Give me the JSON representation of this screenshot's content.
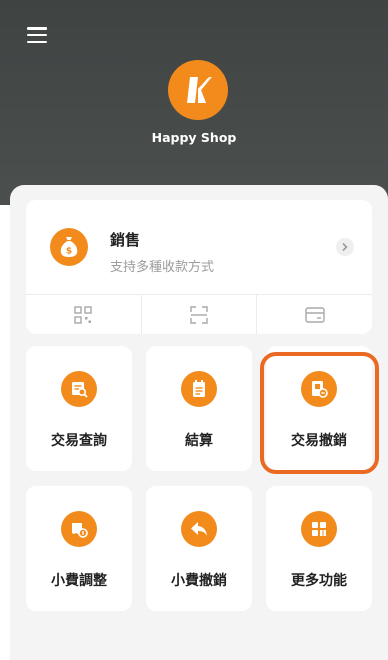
{
  "header": {
    "menu_icon": "hamburger-menu-icon",
    "logo_icon": "shop-logo-k-icon",
    "shop_name": "Happy Shop"
  },
  "sale": {
    "icon": "money-bag-icon",
    "title": "銷售",
    "subtitle": "支持多種收款方式",
    "chevron_icon": "chevron-right-icon",
    "payment_methods": [
      {
        "icon": "qr-code-icon"
      },
      {
        "icon": "scan-icon"
      },
      {
        "icon": "card-icon"
      }
    ]
  },
  "functions": [
    {
      "label": "交易查詢",
      "icon": "transaction-search-icon"
    },
    {
      "label": "結算",
      "icon": "settlement-icon"
    },
    {
      "label": "交易撤銷",
      "icon": "transaction-void-icon",
      "highlighted": true
    },
    {
      "label": "小費調整",
      "icon": "tip-adjust-icon"
    },
    {
      "label": "小費撤銷",
      "icon": "tip-void-icon"
    },
    {
      "label": "更多功能",
      "icon": "more-functions-icon"
    }
  ],
  "colors": {
    "accent": "#f28b1c",
    "header_bg": "#444847",
    "highlight": "#ea6a24"
  }
}
